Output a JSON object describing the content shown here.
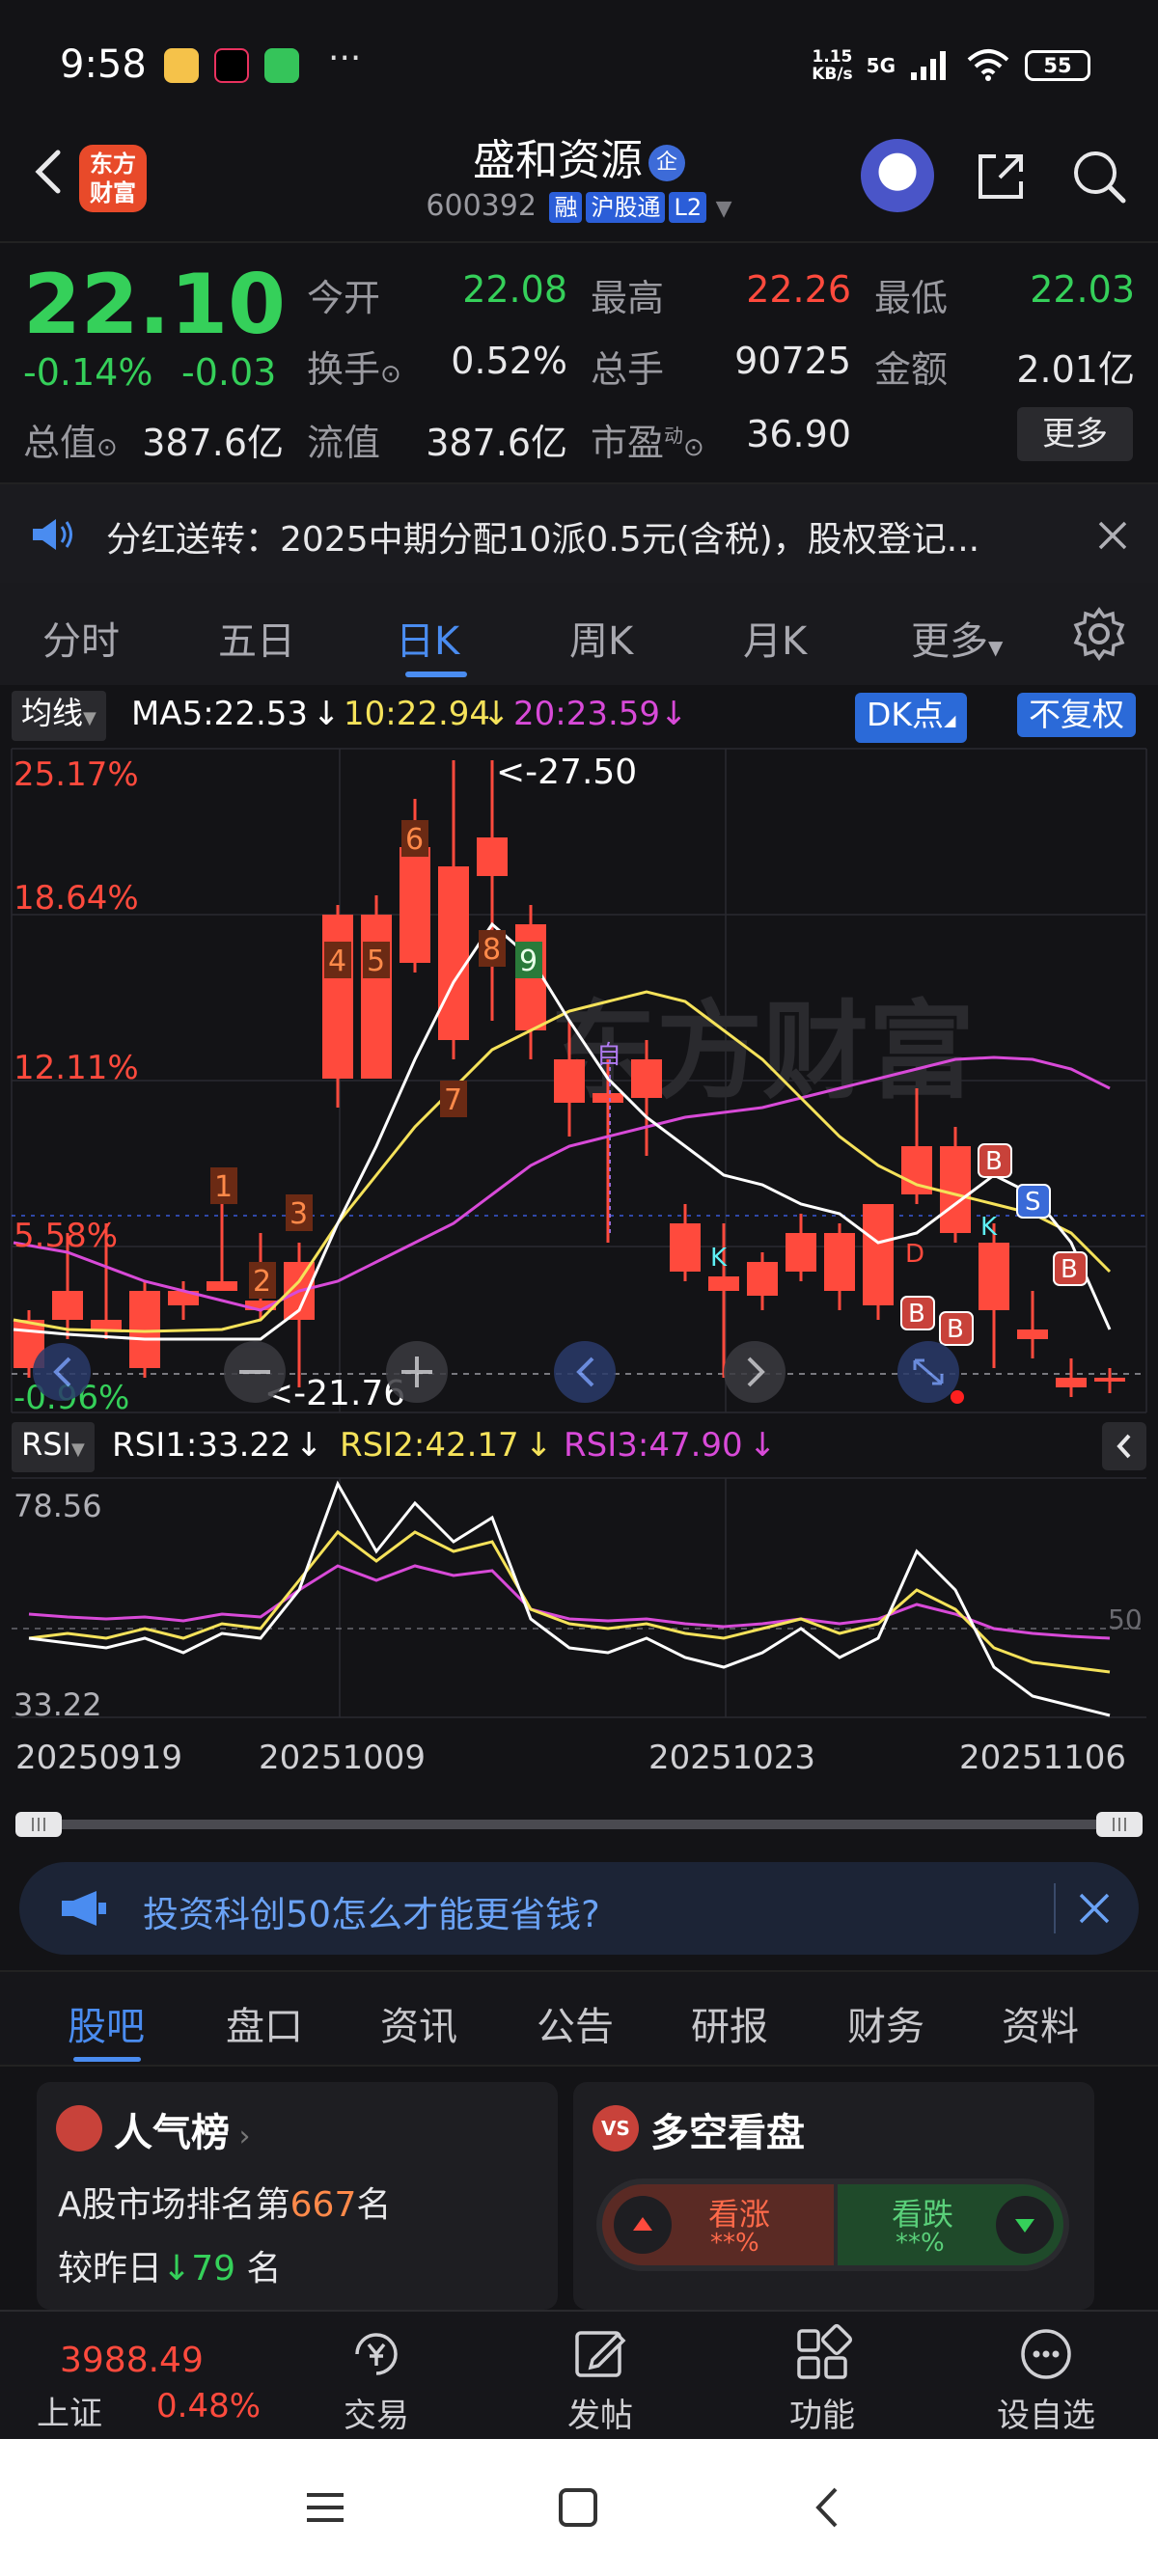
{
  "status_bar": {
    "time": "9:58",
    "net_speed": "1.15",
    "net_unit": "KB/s",
    "network": "5G",
    "battery": "55",
    "more": "···"
  },
  "header": {
    "logo_line1": "东方",
    "logo_line2": "财富",
    "title": "盛和资源",
    "qi_badge": "企",
    "code": "600392",
    "tags": [
      "融",
      "沪股通",
      "L2"
    ]
  },
  "quote": {
    "price": "22.10",
    "change_pct": "-0.14%",
    "change": "-0.03",
    "fields": [
      {
        "label": "今开",
        "value": "22.08",
        "color": "#35d05a"
      },
      {
        "label": "最高",
        "value": "22.26",
        "color": "#ff4a3d"
      },
      {
        "label": "最低",
        "value": "22.03",
        "color": "#35d05a"
      },
      {
        "label": "换手",
        "value": "0.52%",
        "color": "#e8e8ea"
      },
      {
        "label": "总手",
        "value": "90725",
        "color": "#e8e8ea"
      },
      {
        "label": "金额",
        "value": "2.01亿",
        "color": "#e8e8ea"
      },
      {
        "label": "总值",
        "value": "387.6亿",
        "color": "#e8e8ea"
      },
      {
        "label": "流值",
        "value": "387.6亿",
        "color": "#e8e8ea"
      },
      {
        "label": "市盈",
        "value": "36.90",
        "color": "#e8e8ea"
      }
    ],
    "pe_superscript": "动",
    "more_button": "更多"
  },
  "notice": {
    "text": "分红送转：2025中期分配10派0.5元(含税)，股权登记..."
  },
  "period_tabs": [
    "分时",
    "五日",
    "日K",
    "周K",
    "月K",
    "更多"
  ],
  "active_period": "日K",
  "ma_header": {
    "selector": "均线",
    "ma5": "MA5:22.53",
    "ma10": "10:22.94",
    "ma20": "20:23.59",
    "dk_button": "DK点",
    "fuquan_button": "不复权"
  },
  "kchart": {
    "y_labels": [
      "25.17%",
      "18.64%",
      "12.11%",
      "5.58%",
      "-0.96%"
    ],
    "high_label": "<-27.50",
    "low_label": "<-21.76",
    "seq_labels": [
      "1",
      "2",
      "3",
      "4",
      "5",
      "6",
      "7",
      "8",
      "9"
    ],
    "markers": {
      "b": "B",
      "s": "S",
      "k": "K",
      "d": "D",
      "zi": "自"
    },
    "watermark": "东方财富"
  },
  "chart_data": {
    "type": "candlestick",
    "x_tick_labels": [
      "20250919",
      "20251009",
      "20251023",
      "20251106"
    ],
    "y_axis_labels": [
      "25.17%",
      "18.64%",
      "12.11%",
      "5.58%",
      "-0.96%"
    ],
    "max_marker": "27.50",
    "min_marker": "21.76",
    "ma_values": {
      "MA5": 22.53,
      "MA10": 22.94,
      "MA20": 23.59
    },
    "rsi_values": {
      "RSI1": 33.22,
      "RSI2": 42.17,
      "RSI3": 47.9
    },
    "rsi_axis": [
      "78.56",
      "33.22"
    ],
    "rsi_ref": "50"
  },
  "rsi": {
    "selector": "RSI",
    "rsi1": "RSI1:33.22",
    "rsi2": "RSI2:42.17",
    "rsi3": "RSI3:47.90",
    "top": "78.56",
    "bottom": "33.22",
    "ref": "50"
  },
  "dates": [
    "20250919",
    "20251009",
    "20251023",
    "20251106"
  ],
  "ad": {
    "text": "投资科创50怎么才能更省钱?"
  },
  "bottom_tabs": [
    "股吧",
    "盘口",
    "资讯",
    "公告",
    "研报",
    "财务",
    "资料"
  ],
  "cards": {
    "popularity": {
      "title": "人气榜",
      "rank_prefix": "A股市场排名第",
      "rank": "667",
      "rank_suffix": "名",
      "compare_prefix": "较昨日",
      "compare_value": "79",
      "compare_suffix": "名"
    },
    "vote": {
      "title": "多空看盘",
      "badge": "VS",
      "up_label": "看涨",
      "up_value": "**%",
      "down_label": "看跌",
      "down_value": "**%"
    }
  },
  "bottom_nav": {
    "index_value": "3988.49",
    "index_name": "上证",
    "index_change": "0.48%",
    "items": [
      "交易",
      "发帖",
      "功能",
      "设自选"
    ]
  },
  "colors": {
    "up": "#ff4a3d",
    "down": "#35d05a",
    "accent": "#4a8cf0",
    "candle_down": "#5ef0f5",
    "ma5": "#ffffff",
    "ma10": "#f5e25a",
    "ma20": "#d84ad8"
  }
}
